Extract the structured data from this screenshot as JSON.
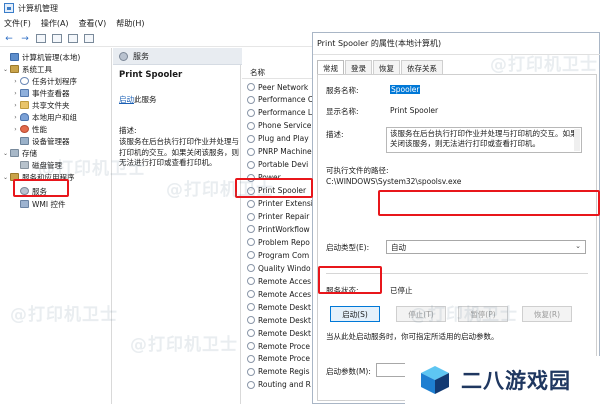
{
  "window": {
    "title": "计算机管理"
  },
  "menu": [
    "文件(F)",
    "操作(A)",
    "查看(V)",
    "帮助(H)"
  ],
  "toolbar": {
    "back_glyph": "←",
    "forward_glyph": "→"
  },
  "tree": [
    {
      "label": "计算机管理(本地)",
      "level": 0,
      "caret": "",
      "icon": "computer-icon"
    },
    {
      "label": "系统工具",
      "level": 1,
      "caret": "⌄",
      "icon": "tools-icon"
    },
    {
      "label": "任务计划程序",
      "level": 2,
      "caret": "›",
      "icon": "clock-icon"
    },
    {
      "label": "事件查看器",
      "level": 2,
      "caret": "›",
      "icon": "event-log-icon"
    },
    {
      "label": "共享文件夹",
      "level": 2,
      "caret": "›",
      "icon": "folder-icon"
    },
    {
      "label": "本地用户和组",
      "level": 2,
      "caret": "›",
      "icon": "users-icon"
    },
    {
      "label": "性能",
      "level": 2,
      "caret": "›",
      "icon": "performance-icon"
    },
    {
      "label": "设备管理器",
      "level": 2,
      "caret": "",
      "icon": "device-icon"
    },
    {
      "label": "存储",
      "level": 1,
      "caret": "⌄",
      "icon": "storage-icon"
    },
    {
      "label": "磁盘管理",
      "level": 2,
      "caret": "",
      "icon": "disk-icon"
    },
    {
      "label": "服务和应用程序",
      "level": 1,
      "caret": "⌄",
      "icon": "apps-icon"
    },
    {
      "label": "服务",
      "level": 2,
      "caret": "",
      "icon": "services-icon"
    },
    {
      "label": "WMI 控件",
      "level": 2,
      "caret": "",
      "icon": "wmi-icon"
    }
  ],
  "middle": {
    "header": "服务",
    "service_title": "Print Spooler",
    "start_link": "启动",
    "start_suffix": "此服务",
    "desc_label": "描述:",
    "desc_text": "该服务在后台执行打印作业并处理与打印机的交互。如果关闭该服务，则无法进行打印或查看打印机。"
  },
  "list": {
    "col_name": "名称",
    "rows": [
      "Peer Network",
      "Performance C",
      "Performance L",
      "Phone Service",
      "Plug and Play",
      "PNRP Machine",
      "Portable Devi",
      "Power",
      "Print Spooler",
      "Printer Extensi",
      "Printer Repair",
      "PrintWorkflow",
      "Problem Repo",
      "Program Com",
      "Quality Windo",
      "Remote Acces",
      "Remote Acces",
      "Remote Deskt",
      "Remote Deskt",
      "Remote Deskt",
      "Remote Proce",
      "Remote Proce",
      "Remote Regis",
      "Routing and R"
    ]
  },
  "dialog": {
    "title": "Print Spooler 的属性(本地计算机)",
    "tabs": [
      "常规",
      "登录",
      "恢复",
      "依存关系"
    ],
    "service_name_label": "服务名称:",
    "service_name": "Spooler",
    "display_name_label": "显示名称:",
    "display_name": "Print Spooler",
    "desc_label": "描述:",
    "desc_text": "该服务在后台执行打印作业并处理与打印机的交互。如果关闭该服务，则无法进行打印或查看打印机。",
    "path_label": "可执行文件的路径:",
    "path": "C:\\WINDOWS\\System32\\spoolsv.exe",
    "startup_type_label": "启动类型(E):",
    "startup_type": "自动",
    "status_label": "服务状态:",
    "status": "已停止",
    "buttons": {
      "start": "启动(S)",
      "stop": "停止(T)",
      "pause": "暂停(P)",
      "resume": "恢复(R)"
    },
    "hint": "当从此处启动服务时，你可指定所适用的启动参数。",
    "params_label": "启动参数(M):"
  },
  "watermark": "@打印机卫士",
  "logo": {
    "text": "二八游戏园"
  }
}
